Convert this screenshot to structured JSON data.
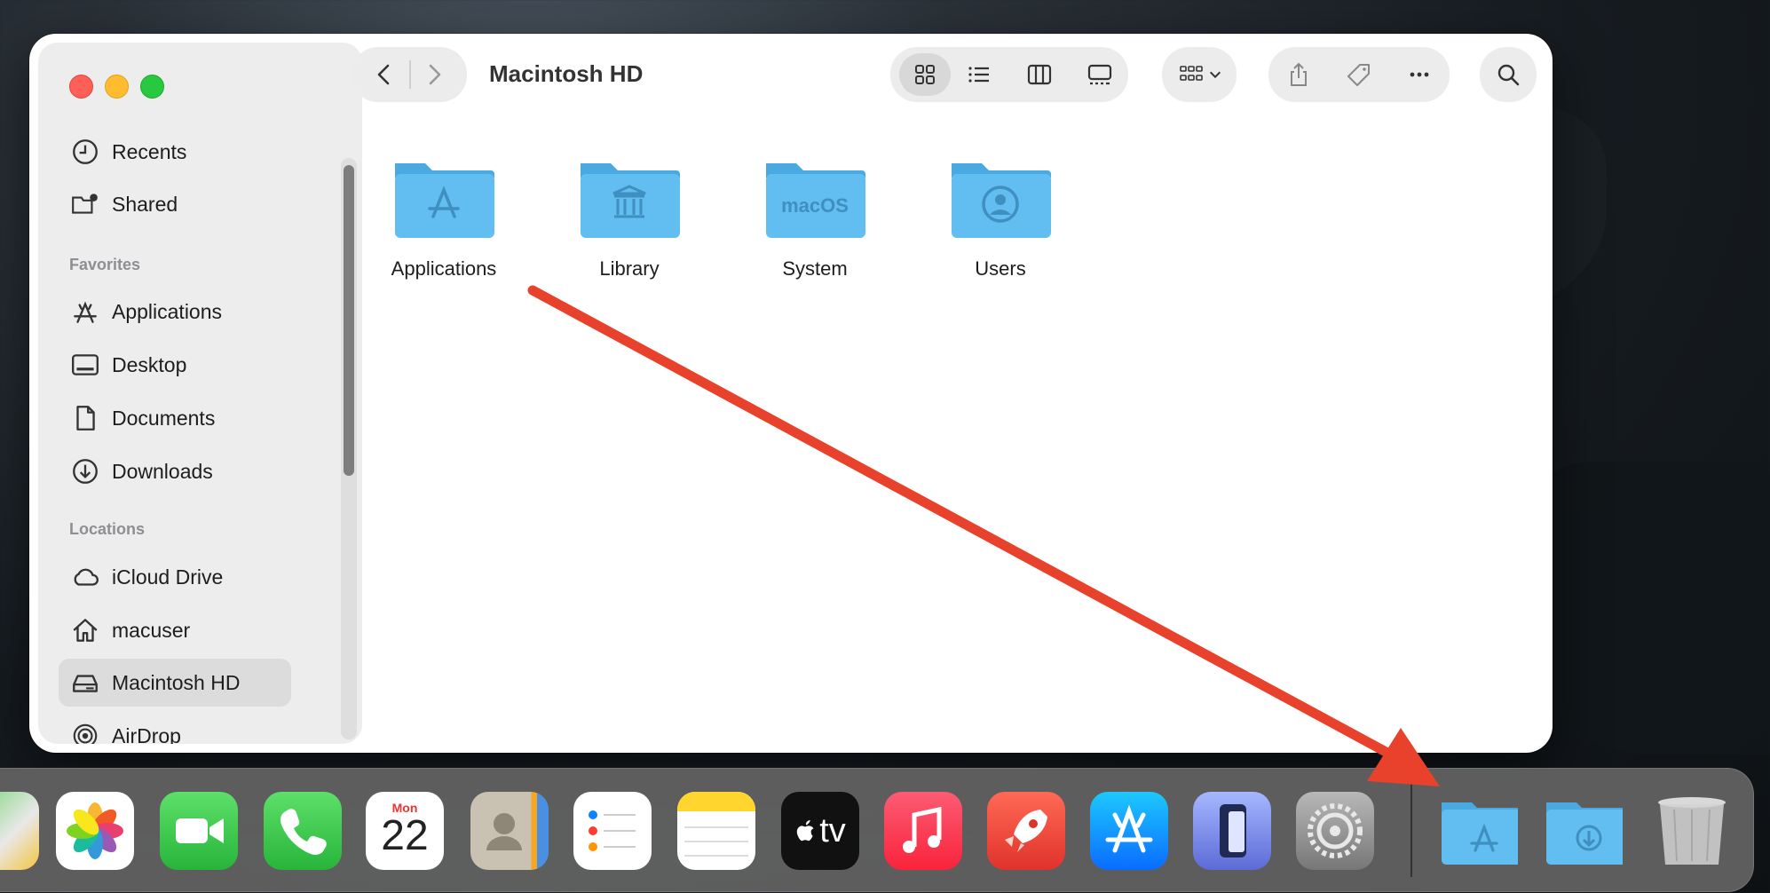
{
  "window": {
    "title": "Macintosh HD"
  },
  "sidebar": {
    "items_top": [
      {
        "label": "Recents",
        "icon": "clock-icon"
      },
      {
        "label": "Shared",
        "icon": "shared-folder-icon"
      }
    ],
    "favorites_heading": "Favorites",
    "favorites": [
      {
        "label": "Applications",
        "icon": "applications-icon"
      },
      {
        "label": "Desktop",
        "icon": "desktop-icon"
      },
      {
        "label": "Documents",
        "icon": "document-icon"
      },
      {
        "label": "Downloads",
        "icon": "download-icon"
      }
    ],
    "locations_heading": "Locations",
    "locations": [
      {
        "label": "iCloud Drive",
        "icon": "cloud-icon"
      },
      {
        "label": "macuser",
        "icon": "home-icon"
      },
      {
        "label": "Macintosh HD",
        "icon": "drive-icon",
        "selected": true
      },
      {
        "label": "AirDrop",
        "icon": "airdrop-icon"
      }
    ]
  },
  "content": {
    "folders": [
      {
        "label": "Applications",
        "glyph": "A"
      },
      {
        "label": "Library",
        "glyph": "columns"
      },
      {
        "label": "System",
        "glyph": "macOS"
      },
      {
        "label": "Users",
        "glyph": "user"
      }
    ]
  },
  "dock": {
    "calendar": {
      "weekday": "Mon",
      "day": "22"
    },
    "tv_label": "tv",
    "apps": [
      "maps",
      "photos",
      "facetime",
      "phone",
      "calendar",
      "contacts",
      "reminders",
      "notes",
      "tv",
      "music",
      "rocket",
      "app-store",
      "simulator",
      "system-settings"
    ],
    "right": [
      "applications-folder",
      "downloads-folder",
      "trash"
    ]
  },
  "colors": {
    "arrow": "#e8412c",
    "folder": "#5bb8ec",
    "selected_row": "#dcdcdc"
  }
}
